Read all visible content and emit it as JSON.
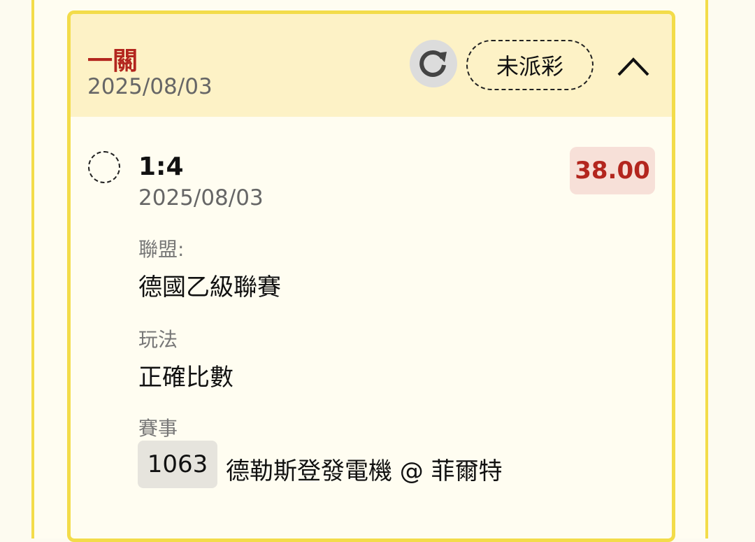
{
  "header": {
    "leg_title": "一關",
    "date": "2025/08/03",
    "status": "未派彩"
  },
  "selection": {
    "score": "1:4",
    "date": "2025/08/03",
    "odds": "38.00"
  },
  "details": {
    "league_label": "聯盟:",
    "league_value": "德國乙級聯賽",
    "bet_type_label": "玩法",
    "bet_type_value": "正確比數",
    "match_label": "賽事",
    "match_code": "1063",
    "match_name": "德勒斯登發電機 @ 菲爾特"
  },
  "icons": {
    "refresh": "refresh-icon",
    "collapse": "chevron-up-icon"
  },
  "colors": {
    "accent_red": "#b3261e",
    "border_yellow": "#f3dc4a",
    "header_bg": "#fdf2c6"
  }
}
